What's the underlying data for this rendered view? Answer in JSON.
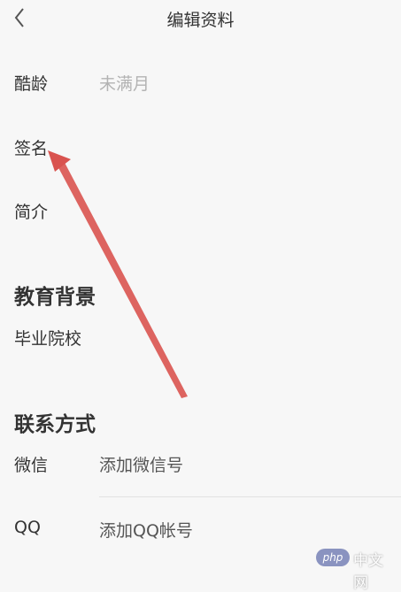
{
  "header": {
    "title": "编辑资料",
    "back_icon": "chevron-left-icon"
  },
  "profile": {
    "age_label": "酷龄",
    "age_value": "未满月",
    "signature_label": "签名",
    "intro_label": "简介"
  },
  "education": {
    "heading": "教育背景",
    "school_label": "毕业院校"
  },
  "contact": {
    "heading": "联系方式",
    "wechat_label": "微信",
    "wechat_placeholder": "添加微信号",
    "qq_label": "QQ",
    "qq_placeholder": "添加QQ帐号"
  },
  "annotation": {
    "arrow_color": "#d9534f"
  },
  "watermark": {
    "logo": "php",
    "text": "中文网"
  }
}
